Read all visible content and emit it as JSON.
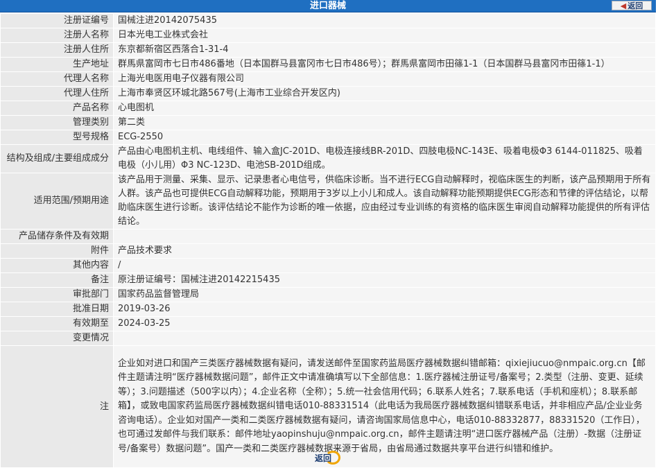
{
  "header": {
    "title": "进口器械",
    "back_label": "返回"
  },
  "rows": [
    {
      "label": "注册证编号",
      "value": "国械注进20142075435"
    },
    {
      "label": "注册人名称",
      "value": "日本光电工业株式会社"
    },
    {
      "label": "注册人住所",
      "value": "东京都新宿区西落合1-31-4"
    },
    {
      "label": "生产地址",
      "value": "群馬県富岡市七日市486番地（日本国群马县富冈市七日市486号）；群馬県富岡市田篠1-1（日本国群马县富冈市田篠1-1）"
    },
    {
      "label": "代理人名称",
      "value": "上海光电医用电子仪器有限公司"
    },
    {
      "label": "代理人住所",
      "value": "上海市奉贤区环城北路567号(上海市工业综合开发区内)"
    },
    {
      "label": "产品名称",
      "value": "心电图机"
    },
    {
      "label": "管理类别",
      "value": "第二类"
    },
    {
      "label": "型号规格",
      "value": "ECG-2550"
    },
    {
      "label": "结构及组成/主要组成成分",
      "value": "产品由心电图机主机、电线组件、输入盒JC-201D、电极连接线BR-201D、四肢电极NC-143E、吸着电极Φ3 6144-011825、吸着电极（小儿用）Φ3 NC-123D、电池SB-201D组成。"
    },
    {
      "label": "适用范围/预期用途",
      "value": "该产品用于测量、采集、显示、记录患者心电信号，供临床诊断。当不进行ECG自动解释时，视临床医生的判断，该产品预期用于所有人群。该产品也可提供ECG自动解释功能，预期用于3岁以上小儿和成人。该自动解释功能预期提供ECG形态和节律的评估结论，以帮助临床医生进行诊断。该评估结论不能作为诊断的唯一依据，应由经过专业训练的有资格的临床医生审阅自动解释功能提供的所有评估结论。"
    },
    {
      "label": "产品储存条件及有效期",
      "value": ""
    },
    {
      "label": "附件",
      "value": "产品技术要求"
    },
    {
      "label": "其他内容",
      "value": "/"
    },
    {
      "label": "备注",
      "value": "原注册证编号：国械注进20142215435"
    },
    {
      "label": "审批部门",
      "value": "国家药品监督管理局"
    },
    {
      "label": "批准日期",
      "value": "2019-03-26"
    },
    {
      "label": "有效期至",
      "value": "2024-03-25"
    },
    {
      "label": "变更情况",
      "value": ""
    },
    {
      "label": "注",
      "value": "企业如对进口和国产三类医疗器械数据有疑问，请发送邮件至国家药监局医疗器械数据纠错邮箱：qixiejiucuo@nmpaic.org.cn【邮件主题请注明“医疗器械数据问题”，邮件正文中请准确填写以下全部信息：1.医疗器械注册证号/备案号；2.类型（注册、变更、延续等）；3.问题描述（500字以内）；4.企业名称（全称）；5.统一社会信用代码；6.联系人姓名；7.联系电话（手机和座机）；8.联系邮箱】，或致电国家药监局医疗器械数据纠错电话010-88331514（此电话为我局医疗器械数据纠错联系电话，并非相应产品/企业业务咨询电话）。企业如对国产一类和二类医疗器械数据有疑问，请咨询国家局信息中心，电话010-88332877，88331520（工作日），也可通过发邮件与我们联系：邮件地址yaopinshuju@nmpaic.org.cn，邮件主题请注明“进口医疗器械产品（注册）-数据（注册证号/备案号）数据问题”。国产一类和二类医疗器械数据来源于省局，由省局通过数据共享平台进行纠错和维护。"
    }
  ],
  "footer": {
    "back_label": "返回"
  }
}
